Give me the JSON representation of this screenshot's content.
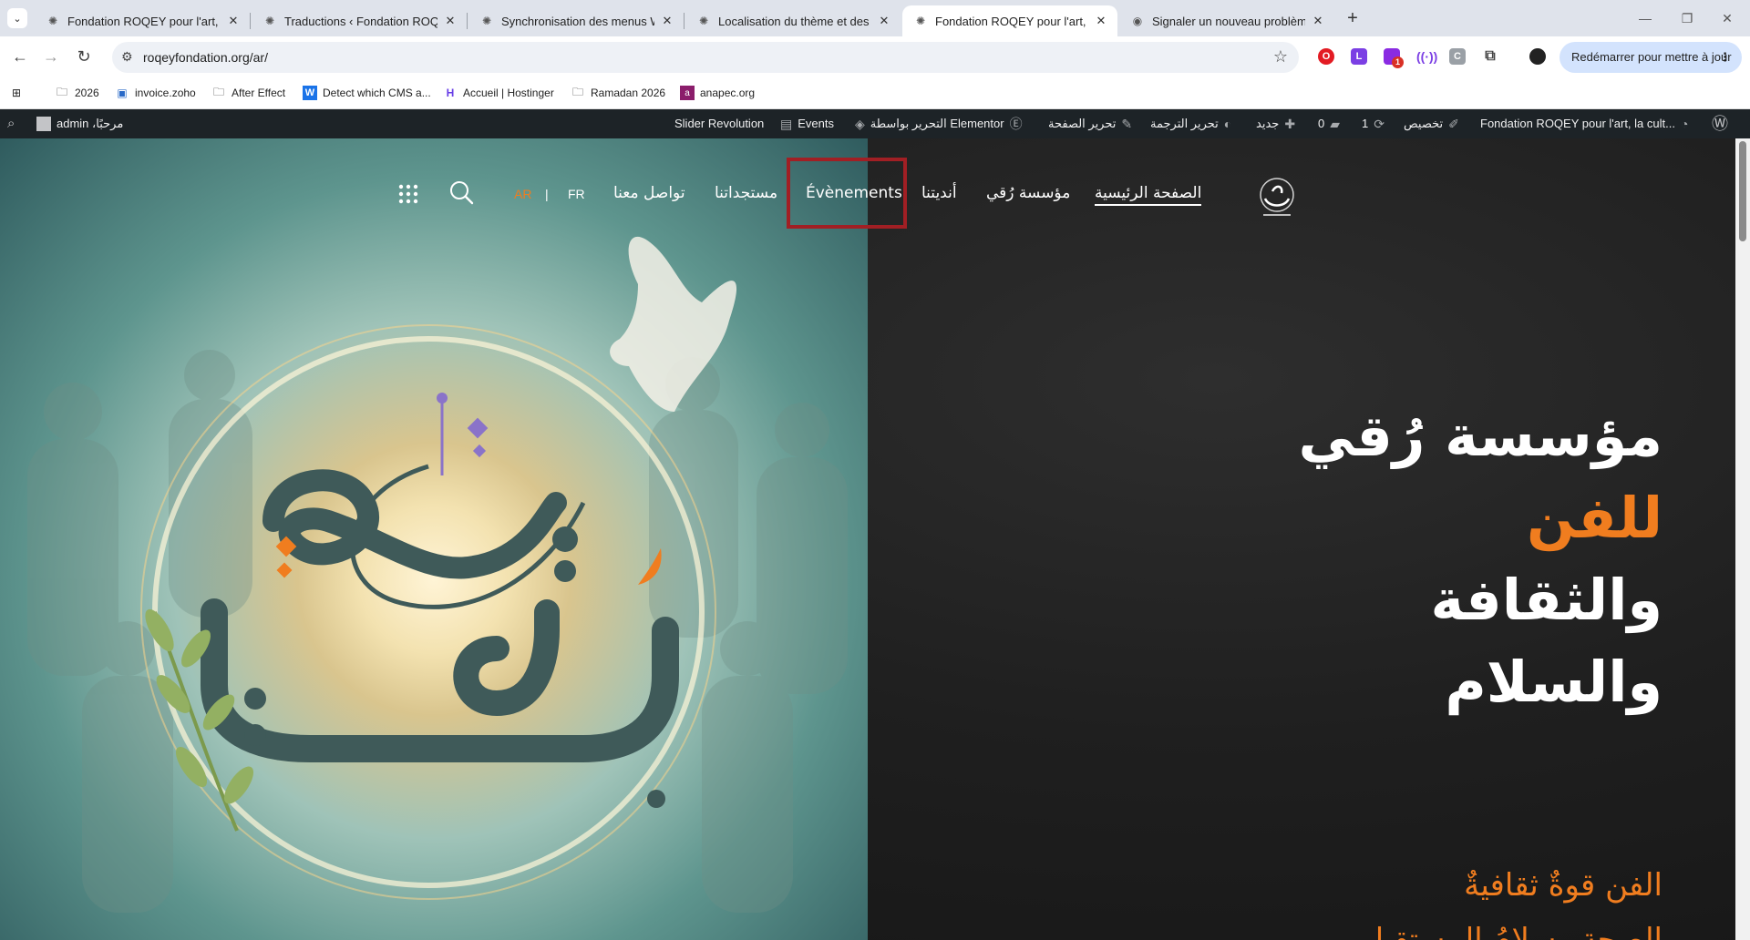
{
  "browser": {
    "tabs": [
      {
        "title": "Fondation ROQEY pour l'art, la",
        "active": false
      },
      {
        "title": "Traductions ‹ Fondation ROQEY",
        "active": false
      },
      {
        "title": "Synchronisation des menus WP",
        "active": false
      },
      {
        "title": "Localisation du thème et des ex",
        "active": false
      },
      {
        "title": "Fondation ROQEY pour l'art, la c",
        "active": true
      },
      {
        "title": "Signaler un nouveau problème",
        "active": false
      }
    ],
    "url": "roqeyfondation.org/ar/",
    "restart_label": "Redémarrer pour mettre à jour",
    "bookmarks": [
      {
        "label": "2026",
        "icon": "folder-icon"
      },
      {
        "label": "invoice.zoho",
        "icon": "zoho-icon"
      },
      {
        "label": "After Effect",
        "icon": "folder-icon"
      },
      {
        "label": "Detect which CMS a...",
        "icon": "w-icon"
      },
      {
        "label": "Accueil | Hostinger",
        "icon": "hostinger-icon"
      },
      {
        "label": "Ramadan 2026",
        "icon": "folder-icon"
      },
      {
        "label": "anapec.org",
        "icon": "anapec-icon"
      }
    ],
    "extension_badge": "1"
  },
  "wp_admin_bar": {
    "site_name": "Fondation ROQEY pour l'art, la cult...",
    "customize": "تخصيص",
    "updates_count": "1",
    "comments_count": "0",
    "new": "جديد",
    "edit_translation": "تحرير الترجمة",
    "edit_page": "تحرير الصفحة",
    "edit_with_elementor": "التحرير بواسطة Elementor",
    "events": "Events",
    "slider_revolution": "Slider Revolution",
    "greeting": "مرحبًا، admin"
  },
  "site_nav": {
    "items": [
      {
        "label": "الصفحة الرئيسية",
        "current": true
      },
      {
        "label": "مؤسسة رُقي",
        "current": false
      },
      {
        "label": "أنديتنا",
        "current": false
      },
      {
        "label": "Évènements",
        "current": false
      },
      {
        "label": "مستجداتنا",
        "current": false
      },
      {
        "label": "تواصل معنا",
        "current": false
      }
    ],
    "lang_fr": "FR",
    "lang_separator": "|",
    "lang_ar": "AR"
  },
  "hero": {
    "line1": "مؤسسة رُقي",
    "line2": "للفن",
    "line3": "والثقافة",
    "line4": "والسلام",
    "tagline1": "الفن قوةٌ ثقافيةٌ",
    "tagline2": "الصحة وسلامُ المستقبل"
  },
  "colors": {
    "accent": "#f07d1f",
    "highlight_box": "#a11f24",
    "admin_bar": "#1d2327",
    "restart_button": "#d3e3fd"
  }
}
